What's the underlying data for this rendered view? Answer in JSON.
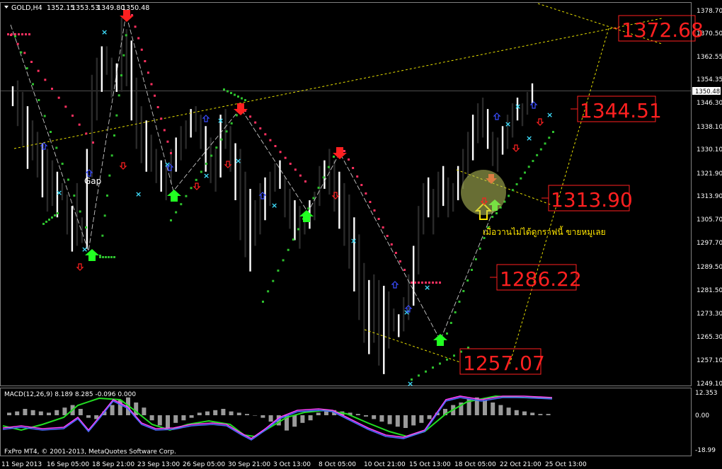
{
  "chart_data": [
    {
      "type": "candlestick",
      "header": {
        "symbol": "GOLD,H4",
        "values": [
          "1352.15",
          "1353.53",
          "1349.80",
          "1350.48"
        ]
      },
      "price_axis": {
        "ticks": [
          1378.7,
          1370.5,
          1362.55,
          1354.35,
          1346.3,
          1338.1,
          1330.1,
          1321.9,
          1313.9,
          1305.7,
          1297.7,
          1289.5,
          1281.5,
          1273.3,
          1265.3,
          1257.1,
          1249.1
        ],
        "tick_labels": [
          "1378.70",
          "1370.50",
          "1362.55",
          "1354.35",
          "1346.30",
          "1338.10",
          "1330.10",
          "1321.90",
          "1313.90",
          "1305.70",
          "1297.70",
          "1289.50",
          "1281.50",
          "1273.30",
          "1265.30",
          "1257.10",
          "1249.10"
        ],
        "ylim": [
          1247,
          1381
        ],
        "current_price": "1350.48"
      },
      "time_axis": {
        "labels": [
          "11 Sep 2013",
          "16 Sep 05:00",
          "18 Sep 21:00",
          "23 Sep 13:00",
          "26 Sep 05:00",
          "30 Sep 21:00",
          "3 Oct 13:00",
          "8 Oct 05:00",
          "10 Oct 21:00",
          "15 Oct 13:00",
          "18 Oct 05:00",
          "22 Oct 21:00",
          "25 Oct 13:00"
        ]
      },
      "annotations": {
        "price_boxes": [
          "1372.68",
          "1344.51",
          "1313.90",
          "1286.22",
          "1257.07"
        ],
        "gap_label": "Gap",
        "thai_note": "เมื่อวานไม่ได้ดูกราฟนี้ ขายหมูเลย"
      },
      "candles_hl": [
        [
          1352,
          1345
        ],
        [
          1354,
          1338
        ],
        [
          1350,
          1331
        ],
        [
          1345,
          1323
        ],
        [
          1340,
          1326
        ],
        [
          1336,
          1320
        ],
        [
          1332,
          1313
        ],
        [
          1330,
          1308
        ],
        [
          1326,
          1310
        ],
        [
          1322,
          1306
        ],
        [
          1318,
          1312
        ],
        [
          1314,
          1300
        ],
        [
          1310,
          1294
        ],
        [
          1318,
          1296
        ],
        [
          1306,
          1297
        ],
        [
          1330,
          1295
        ],
        [
          1356,
          1320
        ],
        [
          1362,
          1340
        ],
        [
          1366,
          1350
        ],
        [
          1366,
          1356
        ],
        [
          1362,
          1348
        ],
        [
          1360,
          1350
        ],
        [
          1376,
          1350
        ],
        [
          1372,
          1352
        ],
        [
          1368,
          1340
        ],
        [
          1355,
          1330
        ],
        [
          1345,
          1325
        ],
        [
          1340,
          1322
        ],
        [
          1335,
          1322
        ],
        [
          1330,
          1318
        ],
        [
          1326,
          1315
        ],
        [
          1325,
          1312
        ],
        [
          1330,
          1318
        ],
        [
          1334,
          1322
        ],
        [
          1338,
          1326
        ],
        [
          1340,
          1330
        ],
        [
          1344,
          1334
        ],
        [
          1345,
          1336
        ],
        [
          1342,
          1330
        ],
        [
          1338,
          1322
        ],
        [
          1334,
          1318
        ],
        [
          1330,
          1315
        ],
        [
          1342,
          1320
        ],
        [
          1344,
          1330
        ],
        [
          1338,
          1322
        ],
        [
          1332,
          1312
        ],
        [
          1330,
          1298
        ],
        [
          1322,
          1292
        ],
        [
          1316,
          1287
        ],
        [
          1312,
          1296
        ],
        [
          1318,
          1300
        ],
        [
          1320,
          1305
        ],
        [
          1322,
          1310
        ],
        [
          1325,
          1315
        ],
        [
          1326,
          1316
        ],
        [
          1320,
          1306
        ],
        [
          1316,
          1302
        ],
        [
          1312,
          1298
        ],
        [
          1310,
          1295
        ],
        [
          1308,
          1300
        ],
        [
          1312,
          1302
        ],
        [
          1315,
          1305
        ],
        [
          1324,
          1310
        ],
        [
          1326,
          1316
        ],
        [
          1330,
          1314
        ],
        [
          1326,
          1308
        ],
        [
          1322,
          1302
        ],
        [
          1318,
          1296
        ],
        [
          1314,
          1288
        ],
        [
          1306,
          1280
        ],
        [
          1300,
          1270
        ],
        [
          1290,
          1262
        ],
        [
          1284,
          1258
        ],
        [
          1286,
          1262
        ],
        [
          1284,
          1254
        ],
        [
          1282,
          1251
        ],
        [
          1280,
          1260
        ],
        [
          1274,
          1266
        ],
        [
          1272,
          1264
        ],
        [
          1278,
          1266
        ],
        [
          1286,
          1270
        ],
        [
          1296,
          1275
        ],
        [
          1310,
          1286
        ],
        [
          1318,
          1300
        ],
        [
          1320,
          1306
        ],
        [
          1316,
          1300
        ],
        [
          1322,
          1306
        ],
        [
          1324,
          1310
        ],
        [
          1320,
          1306
        ],
        [
          1318,
          1308
        ],
        [
          1324,
          1312
        ],
        [
          1330,
          1316
        ],
        [
          1336,
          1320
        ],
        [
          1342,
          1326
        ],
        [
          1346,
          1332
        ],
        [
          1348,
          1334
        ],
        [
          1344,
          1330
        ],
        [
          1336,
          1324
        ],
        [
          1334,
          1322
        ],
        [
          1338,
          1328
        ],
        [
          1342,
          1330
        ],
        [
          1346,
          1334
        ],
        [
          1348,
          1340
        ],
        [
          1346,
          1338
        ],
        [
          1350,
          1342
        ],
        [
          1353,
          1346
        ]
      ]
    },
    {
      "type": "macd",
      "label": "MACD(12,26,9) 8.189 8.285 -0.096 0.000",
      "ticks": [
        12.353,
        0.0,
        -18.99
      ],
      "tick_labels": [
        "12.353",
        "0.00",
        "-18.99"
      ],
      "copyright": "FxPro MT4, © 2001-2013, MetaQuotes Software Corp."
    }
  ]
}
